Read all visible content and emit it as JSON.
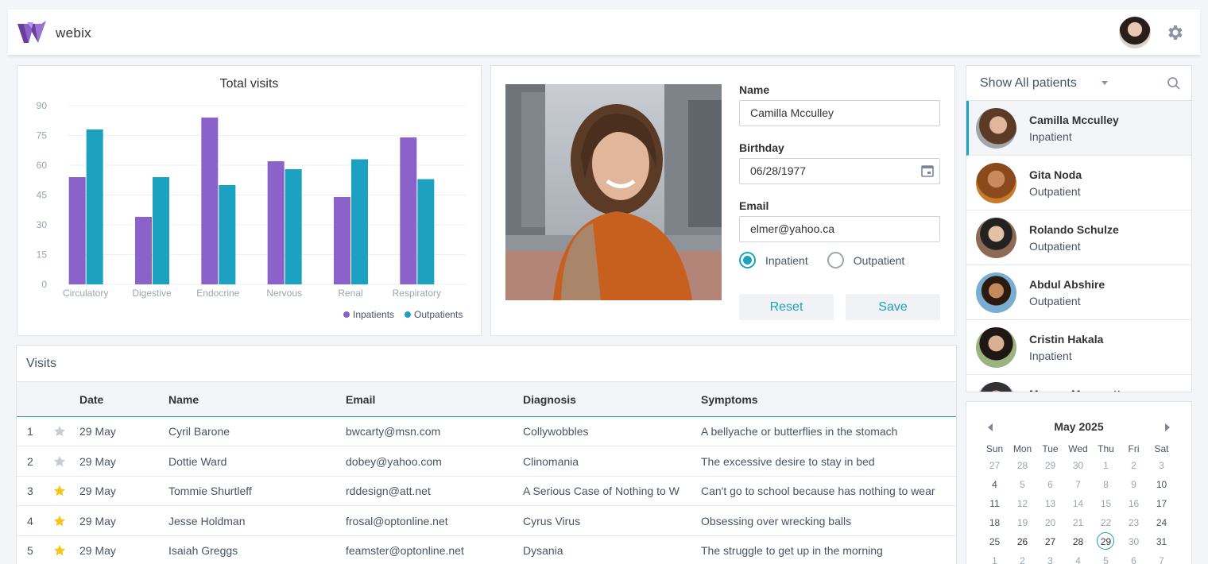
{
  "header": {
    "brand": "webix"
  },
  "chart_data": {
    "type": "bar",
    "title": "Total visits",
    "categories": [
      "Circulatory",
      "Digestive",
      "Endocrine",
      "Nervous",
      "Renal",
      "Respiratory"
    ],
    "series": [
      {
        "name": "Inpatients",
        "color": "#8b62c9",
        "values": [
          54,
          34,
          84,
          62,
          44,
          74
        ]
      },
      {
        "name": "Outpatients",
        "color": "#1ca1c1",
        "values": [
          78,
          54,
          50,
          58,
          63,
          53
        ]
      }
    ],
    "yticks": [
      "0",
      "15",
      "30",
      "45",
      "60",
      "75",
      "90"
    ],
    "ylim": [
      0,
      90
    ],
    "grid": true,
    "legend": "bottom-right"
  },
  "form": {
    "name_label": "Name",
    "name_value": "Camilla Mcculley",
    "birthday_label": "Birthday",
    "birthday_value": "06/28/1977",
    "email_label": "Email",
    "email_value": "elmer@yahoo.ca",
    "radio_inpatient": "Inpatient",
    "radio_outpatient": "Outpatient",
    "selected": "Inpatient",
    "reset_label": "Reset",
    "save_label": "Save"
  },
  "patients": {
    "filter_label": "Show All patients",
    "items": [
      {
        "name": "Camilla Mcculley",
        "status": "Inpatient",
        "selected": true
      },
      {
        "name": "Gita Noda",
        "status": "Outpatient"
      },
      {
        "name": "Rolando Schulze",
        "status": "Outpatient"
      },
      {
        "name": "Abdul Abshire",
        "status": "Outpatient"
      },
      {
        "name": "Cristin Hakala",
        "status": "Inpatient"
      },
      {
        "name": "Marcus Mammott",
        "status": ""
      }
    ]
  },
  "visits": {
    "title": "Visits",
    "columns": [
      "Date",
      "Name",
      "Email",
      "Diagnosis",
      "Symptoms"
    ],
    "rows": [
      {
        "num": "1",
        "starred": false,
        "date": "29 May",
        "name": "Cyril Barone",
        "email": "bwcarty@msn.com",
        "diagnosis": "Collywobbles",
        "symptoms": "A bellyache or butterflies in the stomach"
      },
      {
        "num": "2",
        "starred": false,
        "date": "29 May",
        "name": "Dottie Ward",
        "email": "dobey@yahoo.com",
        "diagnosis": "Clinomania",
        "symptoms": "The excessive desire to stay in bed"
      },
      {
        "num": "3",
        "starred": true,
        "date": "29 May",
        "name": "Tommie Shurtleff",
        "email": "rddesign@att.net",
        "diagnosis": "A Serious Case of Nothing to W",
        "symptoms": "Can't go to school because has nothing to wear"
      },
      {
        "num": "4",
        "starred": true,
        "date": "29 May",
        "name": "Jesse Holdman",
        "email": "frosal@optonline.net",
        "diagnosis": "Cyrus Virus",
        "symptoms": "Obsessing over wrecking balls"
      },
      {
        "num": "5",
        "starred": true,
        "date": "29 May",
        "name": "Isaiah Greggs",
        "email": "feamster@optonline.net",
        "diagnosis": "Dysania",
        "symptoms": "The struggle to get up in the morning"
      }
    ]
  },
  "calendar": {
    "title": "May 2025",
    "dow": [
      "Sun",
      "Mon",
      "Tue",
      "Wed",
      "Thu",
      "Fri",
      "Sat"
    ],
    "weeks": [
      [
        {
          "d": "27",
          "cur": false
        },
        {
          "d": "28",
          "cur": false
        },
        {
          "d": "29",
          "cur": false
        },
        {
          "d": "30",
          "cur": false
        },
        {
          "d": "1",
          "cur": false
        },
        {
          "d": "2",
          "cur": false
        },
        {
          "d": "3",
          "cur": false
        }
      ],
      [
        {
          "d": "4",
          "cur": false
        },
        {
          "d": "5",
          "cur": false
        },
        {
          "d": "6",
          "cur": false
        },
        {
          "d": "7",
          "cur": false
        },
        {
          "d": "8",
          "cur": false
        },
        {
          "d": "9",
          "cur": false
        },
        {
          "d": "10",
          "cur": false
        }
      ],
      [
        {
          "d": "11",
          "cur": false
        },
        {
          "d": "12",
          "cur": false
        },
        {
          "d": "13",
          "cur": false
        },
        {
          "d": "14",
          "cur": false
        },
        {
          "d": "15",
          "cur": false
        },
        {
          "d": "16",
          "cur": false
        },
        {
          "d": "17",
          "cur": false
        }
      ],
      [
        {
          "d": "18",
          "cur": false
        },
        {
          "d": "19",
          "cur": false
        },
        {
          "d": "20",
          "cur": false
        },
        {
          "d": "21",
          "cur": false
        },
        {
          "d": "22",
          "cur": false
        },
        {
          "d": "23",
          "cur": false
        },
        {
          "d": "24",
          "cur": false
        }
      ],
      [
        {
          "d": "25",
          "cur": false
        },
        {
          "d": "26",
          "cur": true
        },
        {
          "d": "27",
          "cur": true
        },
        {
          "d": "28",
          "cur": true
        },
        {
          "d": "29",
          "cur": true,
          "today": true
        },
        {
          "d": "30",
          "cur": false
        },
        {
          "d": "31",
          "cur": false
        }
      ],
      [
        {
          "d": "1",
          "cur": false
        },
        {
          "d": "2",
          "cur": false
        },
        {
          "d": "3",
          "cur": false
        },
        {
          "d": "4",
          "cur": false
        },
        {
          "d": "5",
          "cur": false
        },
        {
          "d": "6",
          "cur": false
        },
        {
          "d": "7",
          "cur": false
        }
      ]
    ]
  }
}
